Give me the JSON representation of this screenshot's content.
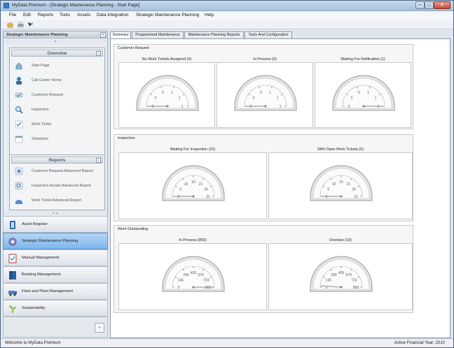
{
  "window": {
    "title": "MyData Premium - [Strategic Maintenance Planning - Start Page]",
    "min": "─",
    "max": "□",
    "close": "✕"
  },
  "menu": [
    "File",
    "Edit",
    "Reports",
    "Tools",
    "Assets",
    "Data Integration",
    "Strategic Maintenance Planning",
    "Help"
  ],
  "toolbar": [
    "open-icon",
    "print-icon",
    "help-icon"
  ],
  "left_panel": {
    "title": "Strategic Maintenance Planning",
    "collapse": "<",
    "overview": {
      "title": "Overview",
      "items": [
        {
          "label": "Start Page",
          "icon": "start-page-icon"
        },
        {
          "label": "Call Center Home",
          "icon": "call-center-icon"
        },
        {
          "label": "Customer Request",
          "icon": "customer-request-icon"
        },
        {
          "label": "Inspection",
          "icon": "inspection-icon"
        },
        {
          "label": "Work Ticket",
          "icon": "work-ticket-icon"
        },
        {
          "label": "Scheduler",
          "icon": "scheduler-icon"
        }
      ]
    },
    "reports": {
      "title": "Reports",
      "items": [
        {
          "label": "Customer Request Advanced Report",
          "icon": "customer-request-report-icon"
        },
        {
          "label": "Inspection Assets Advanced Report",
          "icon": "inspection-report-icon"
        },
        {
          "label": "Work Ticket Advanced Report",
          "icon": "work-ticket-report-icon"
        }
      ]
    },
    "modules": [
      {
        "label": "Asset Register",
        "icon": "asset-register-icon",
        "active": false
      },
      {
        "label": "Strategic Maintenance Planning",
        "icon": "maintenance-planning-icon",
        "active": true
      },
      {
        "label": "Manual Management",
        "icon": "manual-management-icon",
        "active": false
      },
      {
        "label": "Booking Management",
        "icon": "booking-icon",
        "active": false
      },
      {
        "label": "Fleet and Plant Management",
        "icon": "fleet-icon",
        "active": false
      },
      {
        "label": "Sustainability",
        "icon": "sustainability-icon",
        "active": false
      }
    ],
    "more_button": "»"
  },
  "tabs": [
    {
      "label": "Summary",
      "active": true
    },
    {
      "label": "Programmed Maintenance",
      "active": false
    },
    {
      "label": "Maintenance Planning Reports",
      "active": false
    },
    {
      "label": "Tools And Configuration",
      "active": false
    }
  ],
  "groups": [
    {
      "title": "Customer Request",
      "gauges": [
        {
          "title": "No Work Tickets Assigned (0)",
          "ticks": [
            "0",
            "0",
            "0",
            "1",
            "1",
            "1"
          ],
          "value": 0,
          "max": 1
        },
        {
          "title": "In Process (0)",
          "ticks": [
            "0",
            "0",
            "0",
            "1",
            "1",
            "1"
          ],
          "value": 0,
          "max": 1
        },
        {
          "title": "Waiting For Notification (1)",
          "ticks": [
            "0",
            "0",
            "0",
            "1",
            "1",
            "1"
          ],
          "value": 1,
          "max": 1
        }
      ]
    },
    {
      "title": "Inspection",
      "gauges": [
        {
          "title": "Waiting For Inspection (31)",
          "ticks": [
            "0",
            "5",
            "10",
            "16",
            "21",
            "26",
            "31"
          ],
          "value": 0,
          "max": 31
        },
        {
          "title": "With Open Work Tickets (0)",
          "ticks": [
            "0",
            "5",
            "10",
            "16",
            "21",
            "26",
            "31"
          ],
          "value": 0,
          "max": 31
        }
      ]
    },
    {
      "title": "Work Outstanding",
      "gauges": [
        {
          "title": "In Process (850)",
          "ticks": [
            "0",
            "145",
            "290",
            "435",
            "579",
            "724",
            "869"
          ],
          "value": 869,
          "max": 869
        },
        {
          "title": "Overdue (19)",
          "ticks": [
            "0",
            "145",
            "290",
            "435",
            "579",
            "724",
            "869"
          ],
          "value": 19,
          "max": 869
        }
      ]
    }
  ],
  "status": {
    "left": "Welcome to MyData Premium",
    "right": "Active Financial Year: 2010"
  },
  "colors": {
    "title_bar": "#a9c2dc",
    "active_module": "#7db6ec",
    "gauge_needle": "#8a8a8a"
  }
}
